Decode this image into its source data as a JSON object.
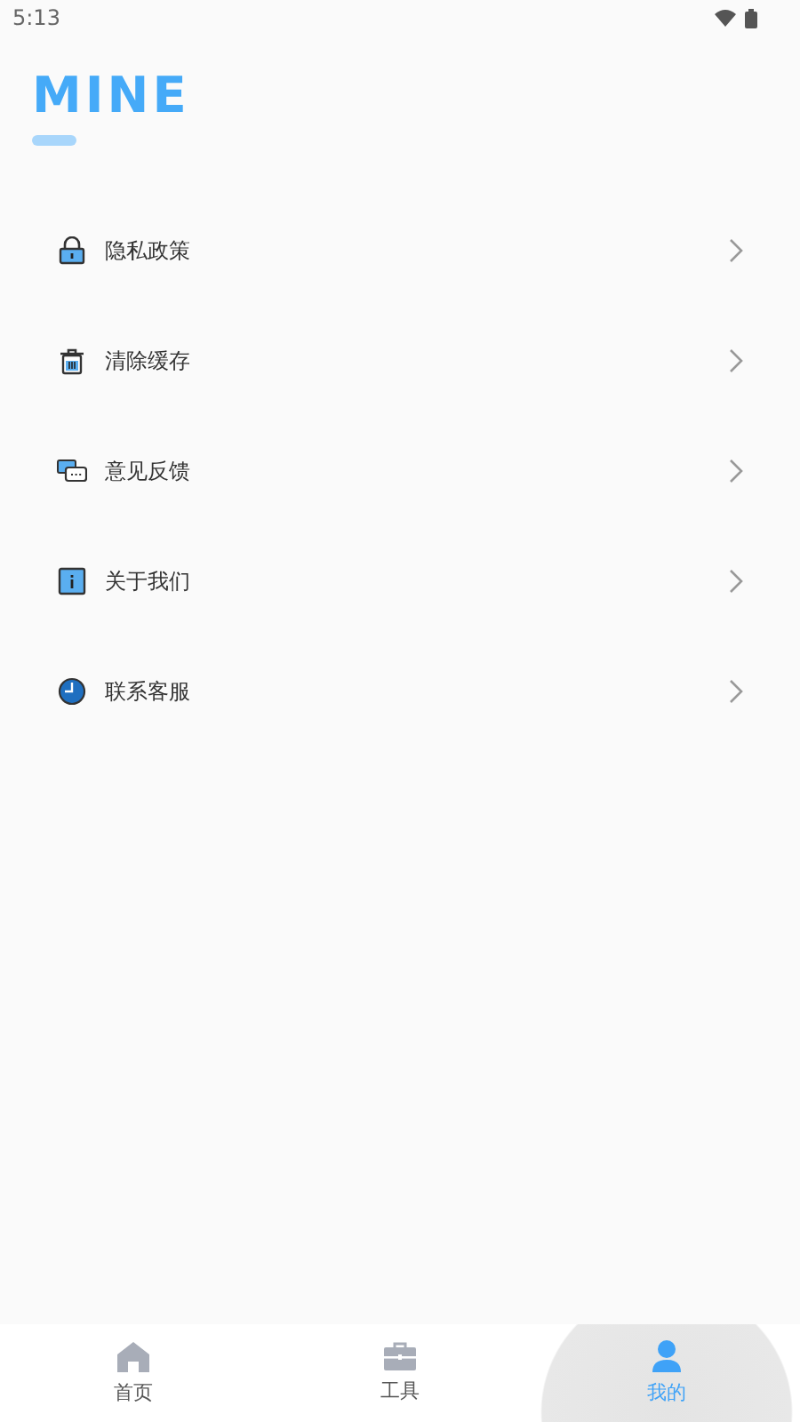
{
  "status_bar": {
    "time": "5:13"
  },
  "title": "MINE",
  "menu": [
    {
      "label": "隐私政策",
      "kind": "lock"
    },
    {
      "label": "清除缓存",
      "kind": "trash"
    },
    {
      "label": "意见反馈",
      "kind": "chat"
    },
    {
      "label": "关于我们",
      "kind": "info"
    },
    {
      "label": "联系客服",
      "kind": "clock"
    }
  ],
  "tabs": [
    {
      "label": "首页",
      "kind": "home",
      "selected": false
    },
    {
      "label": "工具",
      "kind": "toolbox",
      "selected": false
    },
    {
      "label": "我的",
      "kind": "person",
      "selected": true
    }
  ]
}
